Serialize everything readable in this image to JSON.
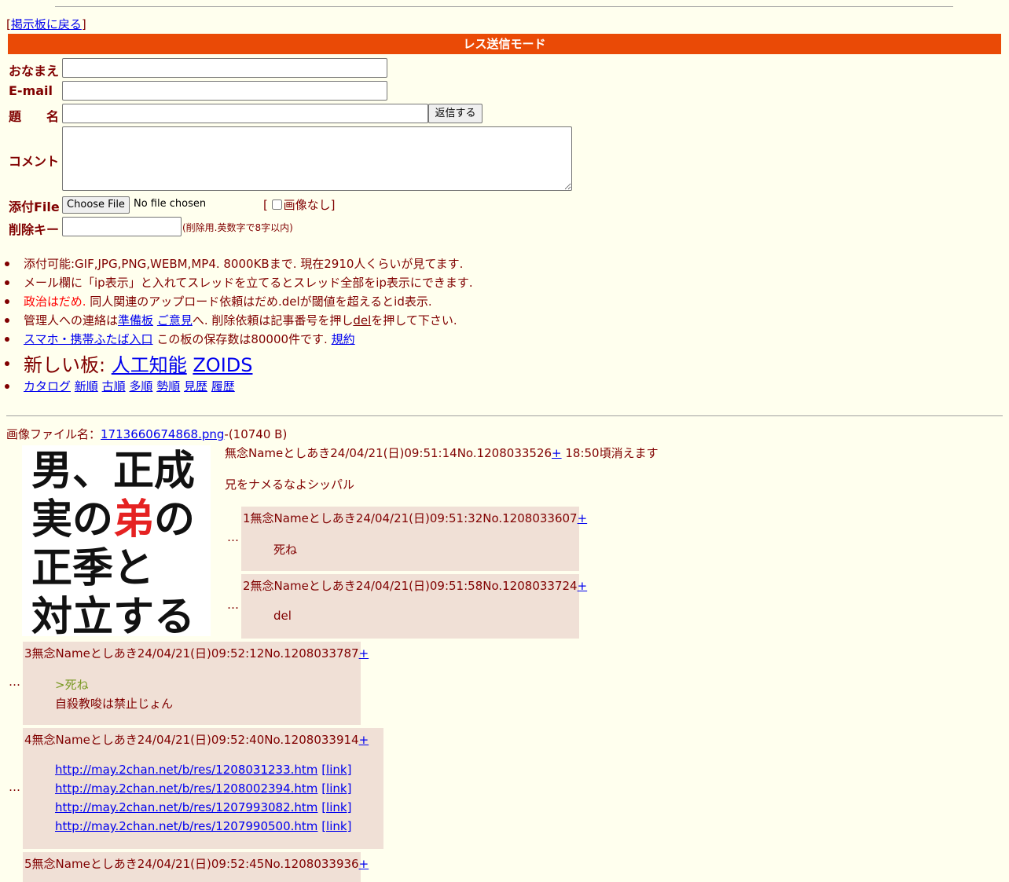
{
  "nav": {
    "back_open": "[",
    "back_link": "掲示板に戻る",
    "back_close": "]"
  },
  "form": {
    "mode_title": "レス送信モード",
    "name_label": "おなまえ",
    "email_label": "E-mail",
    "subject_label": "題　　名",
    "submit_label": "返信する",
    "comment_label": "コメント",
    "file_label": "添付File",
    "file_button": "Choose File",
    "file_status": "No file chosen",
    "noimage_open": "[",
    "noimage_label": "画像なし",
    "noimage_close": "]",
    "delkey_label": "削除キー",
    "delkey_hint": "(削除用.英数字で8字以内)"
  },
  "info": {
    "line1": "添付可能:GIF,JPG,PNG,WEBM,MP4. 8000KBまで. 現在2910人くらいが見てます.",
    "line2": "メール欄に「ip表示」と入れてスレッドを立てるとスレッド全部をip表示にできます.",
    "line3_red": "政治はだめ.",
    "line3_rest": " 同人関連のアップロード依頼はだめ.delが閾値を超えるとid表示.",
    "line4_a": "管理人への連絡は",
    "line4_link1": "準備板",
    "line4_link2": "ご意見",
    "line4_b": "へ. 削除依頼は記事番号を押し",
    "line4_del": "del",
    "line4_c": "を押して下さい.",
    "line5_link": "スマホ・携帯ふたば入口",
    "line5_text": " この板の保存数は80000件です.",
    "line5_rules": "規約",
    "line6_text": "新しい板: ",
    "line6_link1": "人工知能",
    "line6_link2": "ZOIDS",
    "sort_links": [
      "カタログ",
      "新順",
      "古順",
      "多順",
      "勢順",
      "見歴",
      "履歴"
    ]
  },
  "thread": {
    "file_prefix": "画像ファイル名：",
    "file_name": "1713660674868.png",
    "file_size": "-(10740 B)",
    "thumb_lines": [
      "男、正成",
      "実の弟の",
      "正季と",
      "対立する"
    ],
    "thumb_red_char": "弟",
    "thumb_red_color": "#e52222",
    "op_header": "無念Nameとしあき24/04/21(日)09:51:14No.1208033526",
    "op_plus": "+",
    "op_expire": " 18:50頃消えます",
    "op_body": "兄をナメるなよシッパル"
  },
  "replies": [
    {
      "dots": "…",
      "header": "1無念Nameとしあき24/04/21(日)09:51:32No.1208033607",
      "plus": "+",
      "lines": [
        "死ね"
      ]
    },
    {
      "dots": "…",
      "header": "2無念Nameとしあき24/04/21(日)09:51:58No.1208033724",
      "plus": "+",
      "lines": [
        "del"
      ]
    },
    {
      "dots": "…",
      "header": "3無念Nameとしあき24/04/21(日)09:52:12No.1208033787",
      "plus": "+",
      "quote": ">死ね",
      "lines": [
        "自殺教唆は禁止じょん"
      ]
    },
    {
      "dots": "…",
      "header": "4無念Nameとしあき24/04/21(日)09:52:40No.1208033914",
      "plus": "+",
      "links": [
        "http://may.2chan.net/b/res/1208031233.htm",
        "http://may.2chan.net/b/res/1208002394.htm",
        "http://may.2chan.net/b/res/1207993082.htm",
        "http://may.2chan.net/b/res/1207990500.htm"
      ],
      "link_suffix": "[link]"
    },
    {
      "header": "5無念Nameとしあき24/04/21(日)09:52:45No.1208033936",
      "plus": "+"
    }
  ],
  "colors": {
    "background": "#ffffee",
    "text": "#800000",
    "mode_bar": "#ea4a06",
    "reply_bg": "#f0e0d6",
    "link": "#0000ee"
  }
}
